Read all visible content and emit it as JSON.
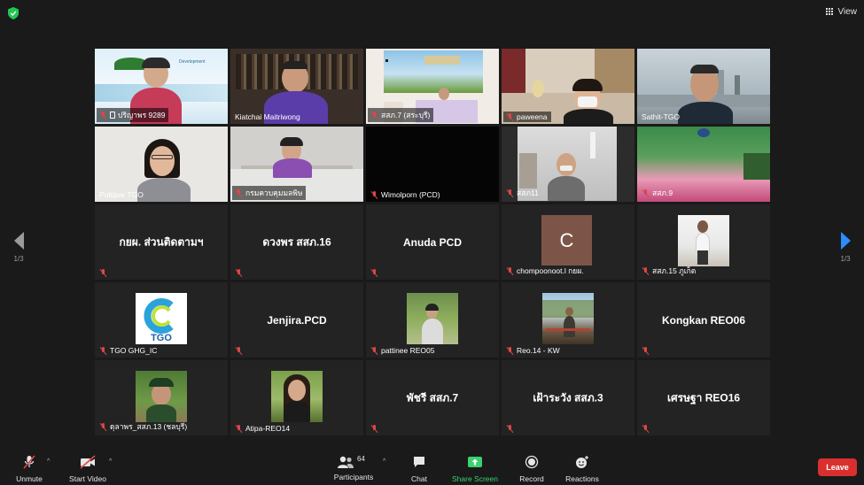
{
  "topbar": {
    "view_label": "View"
  },
  "pagination": {
    "left_count": "1/3",
    "right_count": "1/3"
  },
  "tiles": [
    {
      "name": "ปริญาพร 9289",
      "type": "video",
      "pinned": true
    },
    {
      "name": "Kiatchai Maitriwong",
      "type": "video",
      "active": true
    },
    {
      "name": "สสภ.7 (สระบุรี)",
      "type": "video"
    },
    {
      "name": "paweena",
      "type": "video"
    },
    {
      "name": "Sathit-TGO",
      "type": "video",
      "muted": false
    },
    {
      "name": "Puttipar TGO",
      "type": "video",
      "muted": false
    },
    {
      "name": "กรมควบคุมมลพิษ",
      "type": "video"
    },
    {
      "name": "Wimolporn (PCD)",
      "type": "video"
    },
    {
      "name": "สสภ11",
      "type": "video"
    },
    {
      "name": "สสภ.9",
      "type": "video"
    },
    {
      "name": "กยผ. ส่วนติดตามฯ",
      "type": "name"
    },
    {
      "name": "ดวงพร สสภ.16",
      "type": "name"
    },
    {
      "name": "Anuda PCD",
      "type": "name"
    },
    {
      "name": "chompoonoot.l กยผ.",
      "type": "avatar",
      "letter": "C"
    },
    {
      "name": "สสภ.15 ภูเก็ต",
      "type": "photo"
    },
    {
      "name": "TGO GHG_IC",
      "type": "logo",
      "logo_text": "TGO"
    },
    {
      "name": "Jenjira.PCD",
      "type": "name"
    },
    {
      "name": "pattinee REO05",
      "type": "photo"
    },
    {
      "name": "Reo.14 - KW",
      "type": "photo"
    },
    {
      "name": "Kongkan REO06",
      "type": "name"
    },
    {
      "name": "ดุลาพร_สสภ.13 (ชลบุรี)",
      "type": "photo"
    },
    {
      "name": "Atipa-REO14",
      "type": "photo"
    },
    {
      "name": "พัชรี สสภ.7",
      "type": "name"
    },
    {
      "name": "เฝ้าระวัง สสภ.3",
      "type": "name"
    },
    {
      "name": "เศรษฐา REO16",
      "type": "name"
    }
  ],
  "toolbar": {
    "unmute": "Unmute",
    "start_video": "Start Video",
    "participants": "Participants",
    "participants_count": "64",
    "chat": "Chat",
    "share_screen": "Share Screen",
    "record": "Record",
    "reactions": "Reactions",
    "leave": "Leave"
  },
  "colors": {
    "accent_share": "#3bd16f",
    "leave": "#d9302f",
    "active_border": "#e8e84a",
    "nav_active": "#2d8cff"
  }
}
